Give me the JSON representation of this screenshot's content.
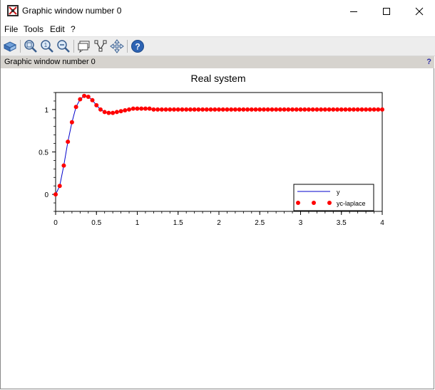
{
  "window": {
    "title": "Graphic window number 0",
    "info_label": "Graphic window number 0",
    "help_mark": "?"
  },
  "menu": {
    "items": [
      "File",
      "Tools",
      "Edit",
      "?"
    ]
  },
  "toolbar": {
    "buttons": [
      "rotate-icon",
      "zoom-in-icon",
      "zoom-reset-icon",
      "zoom-out-icon",
      "datatip-icon",
      "edit-axes-icon",
      "pan-icon",
      "help-icon"
    ]
  },
  "chart_data": {
    "type": "line",
    "title": "Real system",
    "xlabel": "",
    "ylabel": "",
    "xlim": [
      0,
      4
    ],
    "ylim": [
      -0.2,
      1.2
    ],
    "x_ticks": [
      "0",
      "0.5",
      "1",
      "1.5",
      "2",
      "2.5",
      "3",
      "3.5",
      "4"
    ],
    "y_ticks": [
      "0",
      "0.5",
      "1"
    ],
    "grid": false,
    "legend_position": "bottom-right",
    "series": [
      {
        "name": "y",
        "style": "line",
        "color": "#0000cc",
        "x": [
          0,
          0.05,
          0.1,
          0.15,
          0.2,
          0.25,
          0.3,
          0.35,
          0.4,
          0.45,
          0.5,
          0.55,
          0.6,
          0.65,
          0.7,
          0.75,
          0.8,
          0.85,
          0.9,
          0.95,
          1,
          1.05,
          1.1,
          1.15,
          1.2,
          1.25,
          1.3,
          1.35,
          1.4,
          4
        ],
        "values": [
          0,
          0.1,
          0.34,
          0.62,
          0.85,
          1.03,
          1.12,
          1.16,
          1.15,
          1.11,
          1.05,
          1.0,
          0.97,
          0.96,
          0.96,
          0.97,
          0.98,
          0.99,
          1.0,
          1.01,
          1.01,
          1.01,
          1.01,
          1.01,
          1.0,
          1.0,
          1.0,
          1.0,
          1.0,
          1.0
        ]
      },
      {
        "name": "yc-laplace",
        "style": "markers",
        "color": "#ff0000",
        "x": [
          0,
          0.05,
          0.1,
          0.15,
          0.2,
          0.25,
          0.3,
          0.35,
          0.4,
          0.45,
          0.5,
          0.55,
          0.6,
          0.65,
          0.7,
          0.75,
          0.8,
          0.85,
          0.9,
          0.95,
          1,
          1.05,
          1.1,
          1.15,
          1.2,
          1.25,
          1.3,
          1.35,
          1.4,
          1.45,
          1.5,
          1.55,
          1.6,
          1.65,
          1.7,
          1.75,
          1.8,
          1.85,
          1.9,
          1.95,
          2,
          2.05,
          2.1,
          2.15,
          2.2,
          2.25,
          2.3,
          2.35,
          2.4,
          2.45,
          2.5,
          2.55,
          2.6,
          2.65,
          2.7,
          2.75,
          2.8,
          2.85,
          2.9,
          2.95,
          3,
          3.05,
          3.1,
          3.15,
          3.2,
          3.25,
          3.3,
          3.35,
          3.4,
          3.45,
          3.5,
          3.55,
          3.6,
          3.65,
          3.7,
          3.75,
          3.8,
          3.85,
          3.9,
          3.95,
          4
        ],
        "values": [
          0,
          0.1,
          0.34,
          0.62,
          0.85,
          1.03,
          1.12,
          1.16,
          1.15,
          1.11,
          1.05,
          1.0,
          0.97,
          0.96,
          0.96,
          0.97,
          0.98,
          0.99,
          1.0,
          1.01,
          1.01,
          1.01,
          1.01,
          1.01,
          1.0,
          1.0,
          1.0,
          1.0,
          1.0,
          1.0,
          1.0,
          1.0,
          1.0,
          1.0,
          1.0,
          1.0,
          1.0,
          1.0,
          1.0,
          1.0,
          1.0,
          1.0,
          1.0,
          1.0,
          1.0,
          1.0,
          1.0,
          1.0,
          1.0,
          1.0,
          1.0,
          1.0,
          1.0,
          1.0,
          1.0,
          1.0,
          1.0,
          1.0,
          1.0,
          1.0,
          1.0,
          1.0,
          1.0,
          1.0,
          1.0,
          1.0,
          1.0,
          1.0,
          1.0,
          1.0,
          1.0,
          1.0,
          1.0,
          1.0,
          1.0,
          1.0,
          1.0,
          1.0,
          1.0,
          1.0,
          1.0
        ]
      }
    ]
  }
}
